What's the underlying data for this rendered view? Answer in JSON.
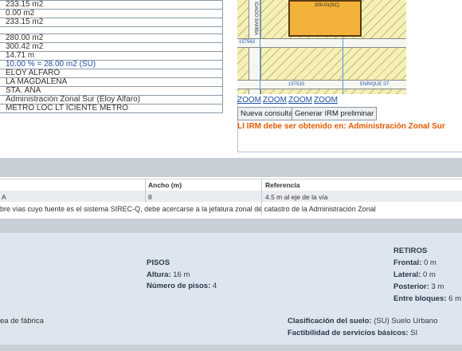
{
  "attributes": {
    "rows": [
      "233.15 m2",
      "0.00 m2",
      "233.15 m2",
      "",
      "280.00 m2",
      "300.42 m2",
      "14.71 m",
      "10.00 % = 28.00 m2 (SU)",
      "ELOY ALFARO",
      "LA MAGDALENA",
      "STA. ANA",
      "Administración Zonal Sur (Eloy Alfaro)",
      "METRO LOC LT ICIENTE    METRO"
    ]
  },
  "map": {
    "lot_label": "200-01(SC)",
    "street_label": "IDAGO BAMBA",
    "label_left": "157563",
    "label_bottom": "157533",
    "label_bottom_right": "ENRIQUE ST"
  },
  "zoom": {
    "links": [
      "ZOOM",
      "ZOOM",
      "ZOOM",
      "ZOOM"
    ]
  },
  "buttons": {
    "nueva_consulta": "Nueva consulta",
    "generar_irm": "Generar IRM preliminar"
  },
  "warning": "LI IRM debe ser obtenido en: Administración Zonal Sur",
  "vias": {
    "headers": {
      "ancho": "Ancho (m)",
      "referencia": "Referencia"
    },
    "row": {
      "name": "A",
      "ancho": "8",
      "referencia": "4.5 m al eje de la vía"
    },
    "note": "bre vías cuyo fuente es el sistema SIREC-Q, debe acercarse a la jefatura zonal de catastro de la Administración Zonal"
  },
  "pisos": {
    "title": "PISOS",
    "altura_label": "Altura:",
    "altura_value": "16 m",
    "numero_label": "Número de pisos:",
    "numero_value": "4"
  },
  "retiros": {
    "title": "RETIROS",
    "frontal_label": "Frontal:",
    "frontal_value": "0 m",
    "lateral_label": "Lateral:",
    "lateral_value": "0 m",
    "posterior_label": "Posterior:",
    "posterior_value": "3 m",
    "entre_label": "Entre bloques:",
    "entre_value": "6 m"
  },
  "suelo": {
    "fabrica_text": "ea de fábrica",
    "clasificacion_label": "Clasificación del suelo:",
    "clasificacion_value": "(SU) Suelo Urbano",
    "factibilidad_label": "Factibilidad de servicios básicos:",
    "factibilidad_value": "SI"
  },
  "colors": {
    "link_blue": "#1f4fa0",
    "warning_orange": "#e05a00",
    "lot_fill": "#f3b23a",
    "map_bg": "#f4f0b8",
    "section_bar": "#c9cfd6",
    "info_bg": "#dde5ee"
  }
}
